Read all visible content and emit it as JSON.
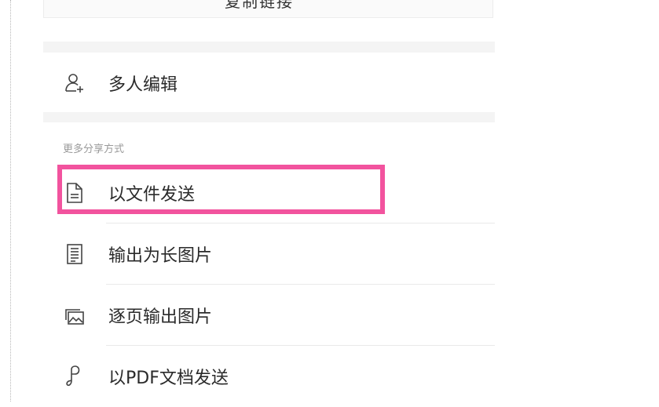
{
  "top_card": {
    "partial_text": "复制链接"
  },
  "collab": {
    "label": "多人编辑",
    "icon": "add-person-icon"
  },
  "more_share": {
    "title": "更多分享方式",
    "items": [
      {
        "label": "以文件发送",
        "icon": "document-icon"
      },
      {
        "label": "输出为长图片",
        "icon": "long-image-icon"
      },
      {
        "label": "逐页输出图片",
        "icon": "image-pages-icon"
      },
      {
        "label": "以PDF文档发送",
        "icon": "pdf-icon"
      }
    ]
  },
  "colors": {
    "highlight": "#f2539e",
    "divider": "#e9e9e9",
    "section_gap": "#f4f4f4"
  }
}
